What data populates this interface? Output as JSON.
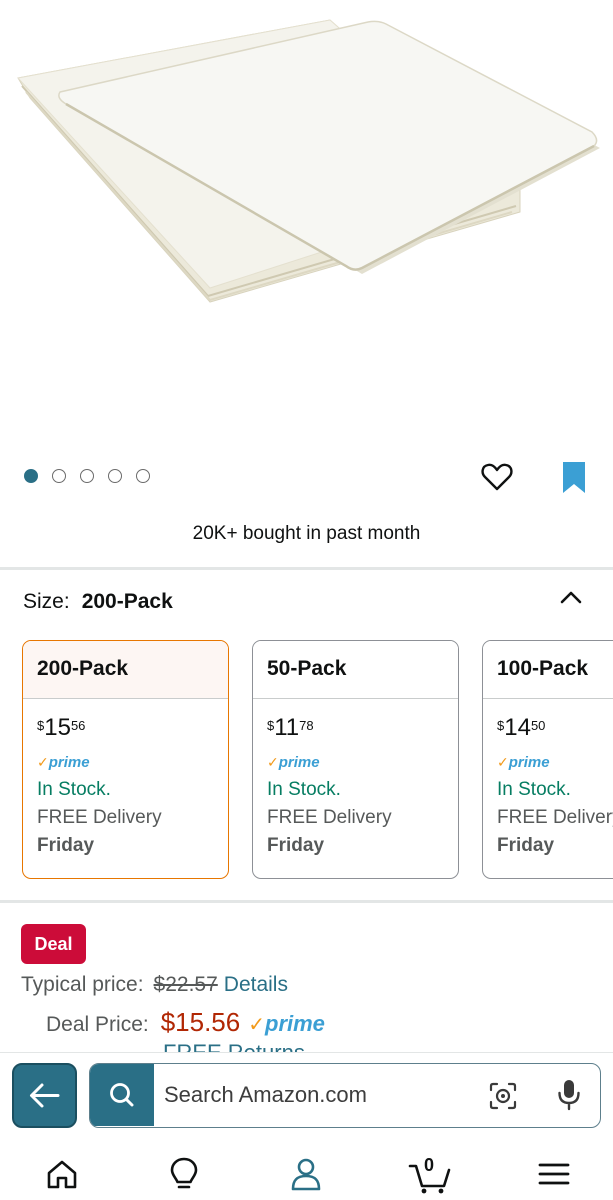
{
  "hero": {
    "carousel": {
      "total": 5,
      "active_index": 0
    },
    "bought_text": "20K+ bought in past month"
  },
  "size": {
    "label": "Size:",
    "selected": "200-Pack",
    "options": [
      {
        "name": "200-Pack",
        "price_symbol": "$",
        "price_whole": "15",
        "price_fraction": "56",
        "prime": "prime",
        "stock": "In Stock.",
        "delivery": "FREE Delivery",
        "delivery_day": "Friday",
        "selected": true
      },
      {
        "name": "50-Pack",
        "price_symbol": "$",
        "price_whole": "11",
        "price_fraction": "78",
        "prime": "prime",
        "stock": "In Stock.",
        "delivery": "FREE Delivery",
        "delivery_day": "Friday",
        "selected": false
      },
      {
        "name": "100-Pack",
        "price_symbol": "$",
        "price_whole": "14",
        "price_fraction": "50",
        "prime": "prime",
        "stock": "In Stock.",
        "delivery": "FREE Delivery",
        "delivery_day": "Friday",
        "selected": false
      }
    ]
  },
  "deal": {
    "badge": "Deal",
    "typical_label": "Typical price:",
    "typical_price": "$22.57",
    "details_link": "Details",
    "deal_label": "Deal Price:",
    "deal_price": "$15.56",
    "prime": "prime",
    "free_returns": "FREE Returns"
  },
  "search": {
    "placeholder": "Search Amazon.com"
  },
  "cart": {
    "count": "0"
  },
  "colors": {
    "accent": "#2a6f86",
    "selected_border": "#e77600",
    "in_stock": "#067d62",
    "deal_badge": "#cc0c39",
    "deal_price": "#b12704",
    "prime_check": "#f29a1a",
    "prime_text": "#3b9fd4"
  },
  "icons": {
    "back": "arrow-left-icon",
    "search": "search-icon",
    "camera": "camera-scan-icon",
    "mic": "microphone-icon",
    "heart": "heart-icon",
    "bookmark": "bookmark-icon",
    "collapse": "chevron-up-icon",
    "home": "home-icon",
    "inspiration": "lightbulb-icon",
    "account": "person-icon",
    "cart": "cart-icon",
    "menu": "hamburger-menu-icon"
  }
}
